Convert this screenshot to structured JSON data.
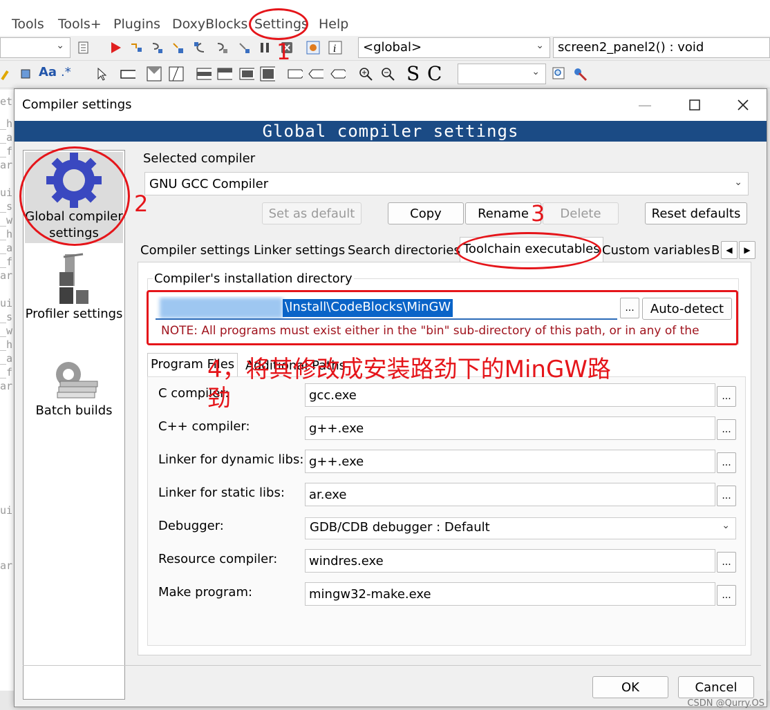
{
  "menubar": {
    "items": [
      "Tools",
      "Tools+",
      "Plugins",
      "DoxyBlocks",
      "Settings",
      "Help"
    ]
  },
  "toolbar": {
    "left_combo_value": "",
    "scope_combo": "<global>",
    "function_combo": "screen2_panel2() : void",
    "search_combo": "",
    "text_s": "S",
    "text_c": "C",
    "aa_label": "Aa",
    "regex_label": ".*"
  },
  "left_code": [
    "et",
    "_h",
    "_a",
    "_f",
    "ar",
    "ui",
    "_s",
    "_w",
    "_h",
    "_a",
    "_f",
    "ar",
    "ui",
    "_s",
    "_w",
    "_h",
    "_a",
    "_f",
    "ar",
    "ui",
    "ar"
  ],
  "dialog": {
    "window_title": "Compiler settings",
    "banner": "Global compiler settings",
    "sidebar": [
      {
        "label": "Global compiler settings",
        "selected": true
      },
      {
        "label": "Profiler settings",
        "selected": false
      },
      {
        "label": "Batch builds",
        "selected": false
      }
    ],
    "selected_compiler_label": "Selected compiler",
    "selected_compiler_value": "GNU GCC Compiler",
    "buttons": {
      "set_default": "Set as default",
      "copy": "Copy",
      "rename": "Rename",
      "delete": "Delete",
      "reset": "Reset defaults"
    },
    "tabs": [
      "Compiler settings",
      "Linker settings",
      "Search directories",
      "Toolchain executables",
      "Custom variables",
      "B"
    ],
    "install_dir_label": "Compiler's installation directory",
    "install_dir_value": "\\Install\\CodeBlocks\\MinGW",
    "browse_label": "...",
    "auto_detect": "Auto-detect",
    "note": "NOTE: All programs must exist either in the \"bin\" sub-directory of this path, or in any of the",
    "inner_tabs": [
      "Program Files",
      "Additional Paths"
    ],
    "programs": [
      {
        "label": "C compiler:",
        "value": "gcc.exe"
      },
      {
        "label": "C++ compiler:",
        "value": "g++.exe"
      },
      {
        "label": "Linker for dynamic libs:",
        "value": "g++.exe"
      },
      {
        "label": "Linker for static libs:",
        "value": "ar.exe"
      },
      {
        "label": "Debugger:",
        "value": "GDB/CDB debugger : Default"
      },
      {
        "label": "Resource compiler:",
        "value": "windres.exe"
      },
      {
        "label": "Make program:",
        "value": "mingw32-make.exe"
      }
    ],
    "ok": "OK",
    "cancel": "Cancel"
  },
  "annotations": {
    "n1": "1",
    "n2": "2",
    "n3": "3",
    "note4_line1": "4，将其修改成安装路劲下的MinGW路",
    "note4_line2": "劲",
    "color": "#e5151a"
  },
  "watermark": "CSDN @Qurry.OS",
  "colors": {
    "banner": "#1b4b85",
    "selection": "#0a64c8"
  }
}
